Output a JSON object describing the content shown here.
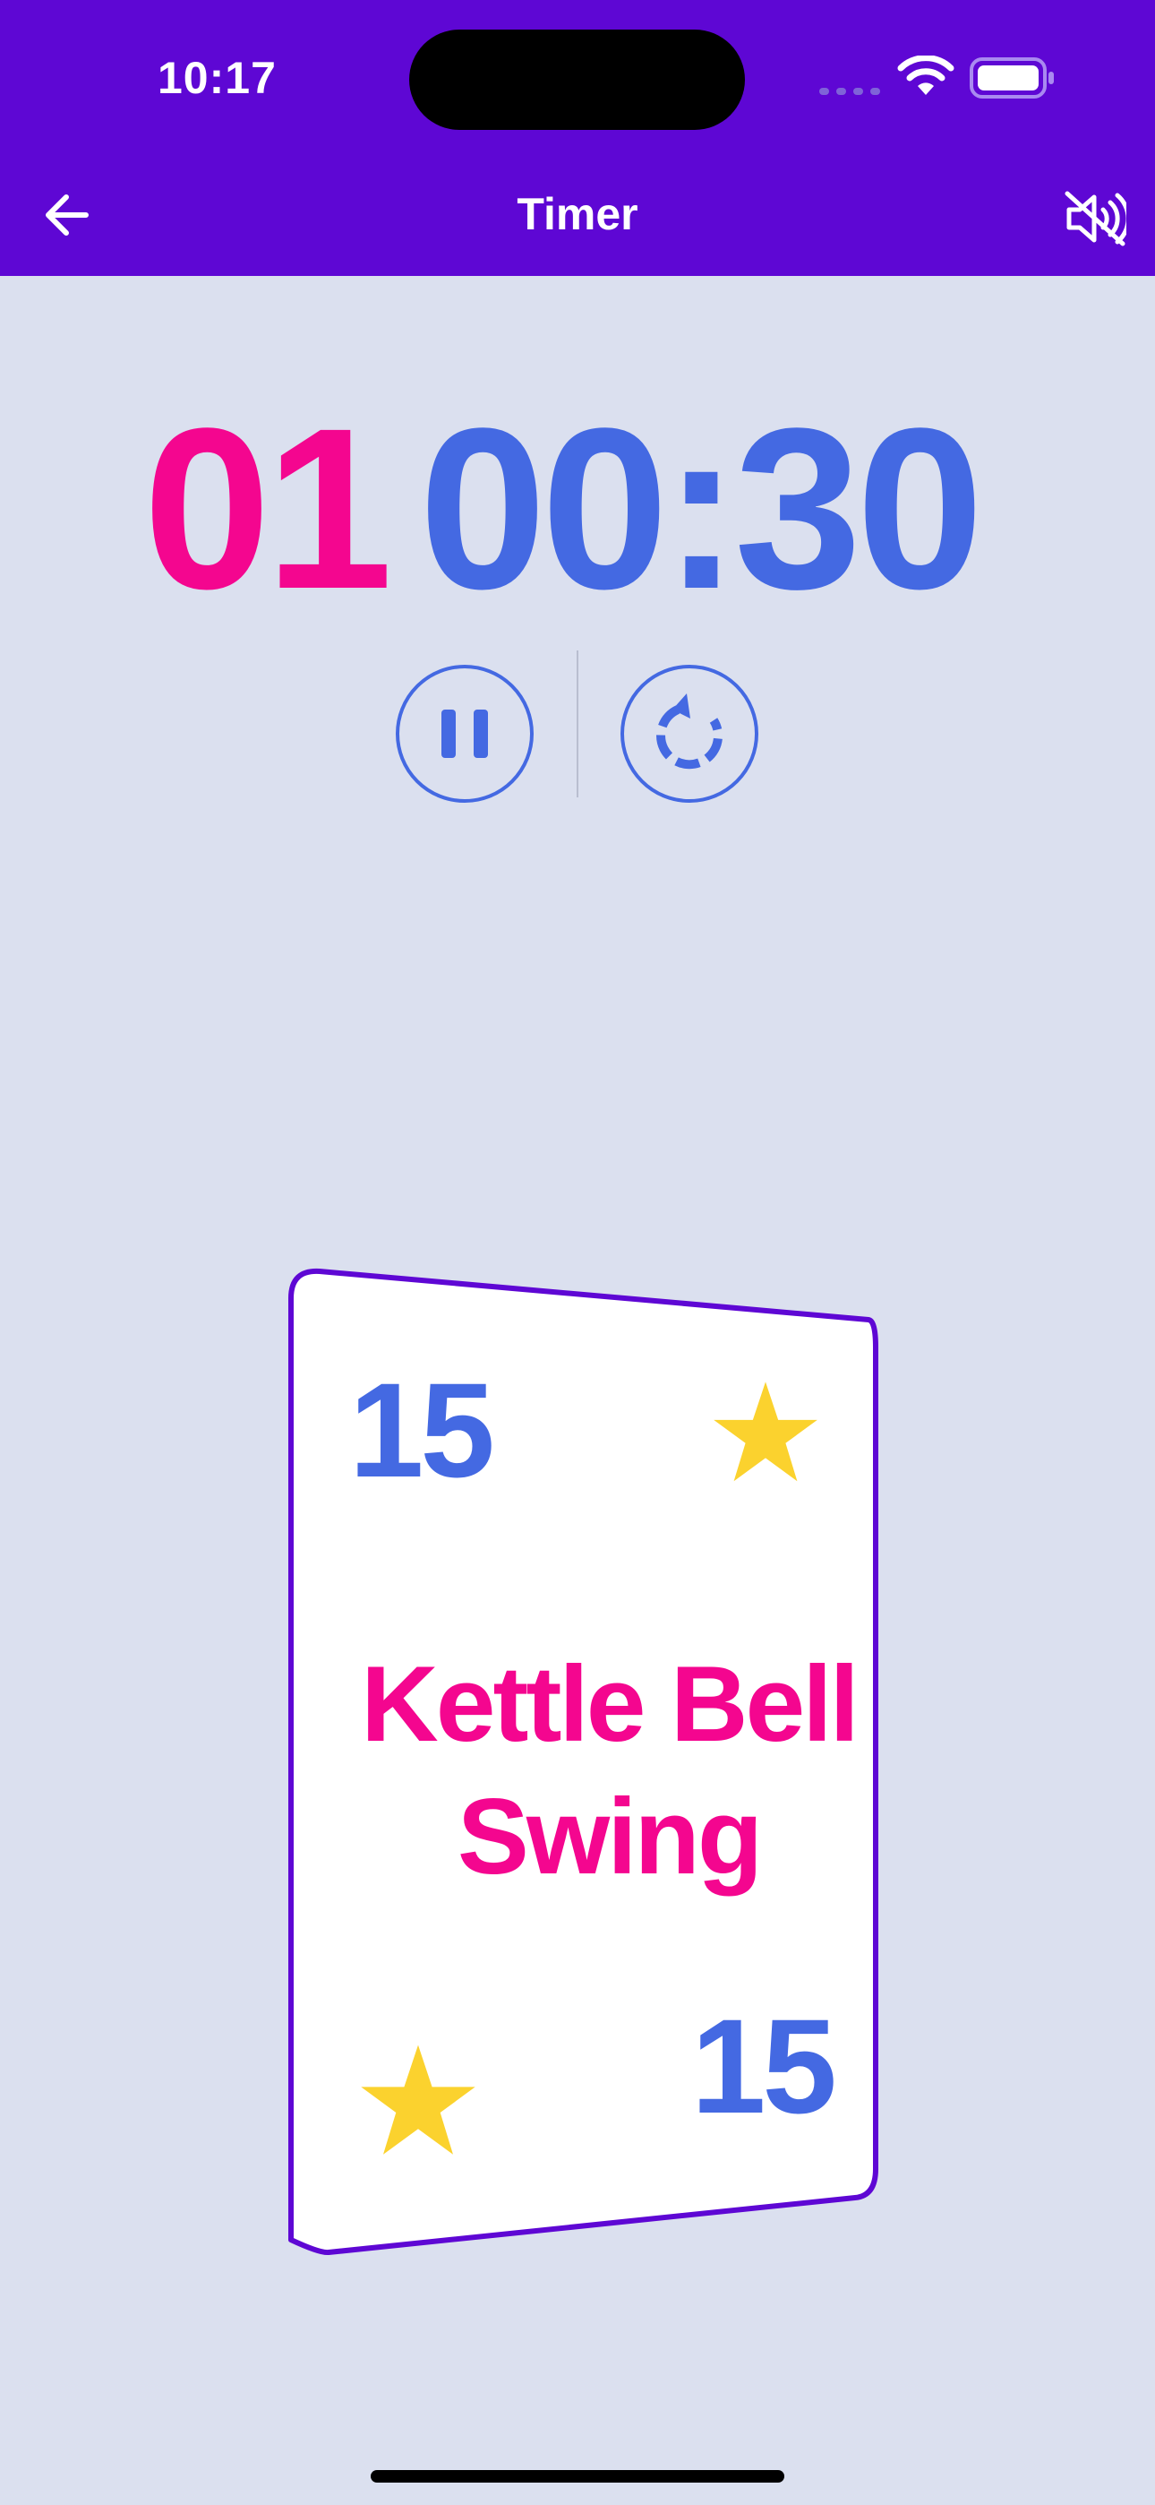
{
  "status_bar": {
    "time": "10:17"
  },
  "header": {
    "title": "Timer",
    "back_icon": "arrow-left-icon",
    "mute_icon": "speaker-muted-icon"
  },
  "timer": {
    "laps": "01",
    "clock": "00:30"
  },
  "controls": {
    "pause_icon": "pause-icon",
    "reset_icon": "reset-icon"
  },
  "card": {
    "reps_top": "15",
    "reps_bottom": "15",
    "exercise_line1": "Kettle Bell",
    "exercise_line2": "Swing"
  },
  "colors": {
    "header": "#5e07d4",
    "background": "#dbe0ef",
    "laps": "#f4068f",
    "clock": "#4469e2",
    "star": "#fbd22e"
  }
}
